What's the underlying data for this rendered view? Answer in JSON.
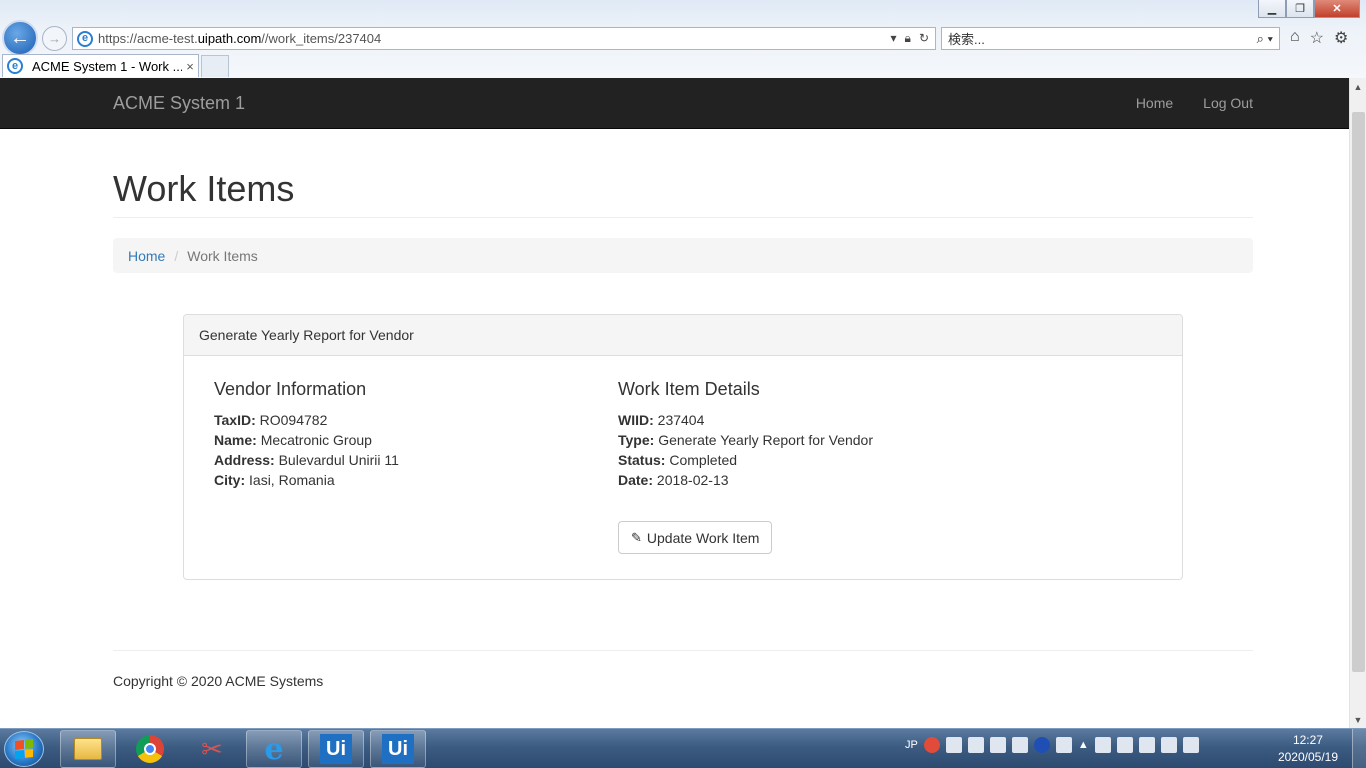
{
  "browser": {
    "url_prefix": "https://acme-test.",
    "url_domain": "uipath.com",
    "url_path": "//work_items/237404",
    "search_placeholder": "検索...",
    "tab_title": "ACME System 1 - Work ...",
    "tab_close": "×"
  },
  "navbar": {
    "brand": "ACME System 1",
    "links": [
      "Home",
      "Log Out"
    ]
  },
  "page": {
    "title": "Work Items",
    "breadcrumb": {
      "home": "Home",
      "separator": "/",
      "current": "Work Items"
    }
  },
  "panel": {
    "heading": "Generate Yearly Report for Vendor",
    "vendor": {
      "title": "Vendor Information",
      "fields": [
        {
          "label": "TaxID:",
          "value": "RO094782"
        },
        {
          "label": "Name:",
          "value": "Mecatronic Group"
        },
        {
          "label": "Address:",
          "value": "Bulevardul Unirii 11"
        },
        {
          "label": "City:",
          "value": "Iasi, Romania"
        }
      ]
    },
    "work_item": {
      "title": "Work Item Details",
      "fields": [
        {
          "label": "WIID:",
          "value": "237404"
        },
        {
          "label": "Type:",
          "value": "Generate Yearly Report for Vendor"
        },
        {
          "label": "Status:",
          "value": "Completed"
        },
        {
          "label": "Date:",
          "value": "2018-02-13"
        }
      ]
    },
    "update_button": "Update Work Item"
  },
  "footer": {
    "copyright": "Copyright © 2020 ACME Systems"
  },
  "taskbar": {
    "lang": "JP",
    "clock_time": "12:27",
    "clock_date": "2020/05/19",
    "apps": [
      "file-explorer-icon",
      "chrome-icon",
      "snipping-tool-icon",
      "internet-explorer-icon",
      "uipath-studio-icon",
      "uipath-robot-icon"
    ],
    "ui_label": "Ui"
  }
}
